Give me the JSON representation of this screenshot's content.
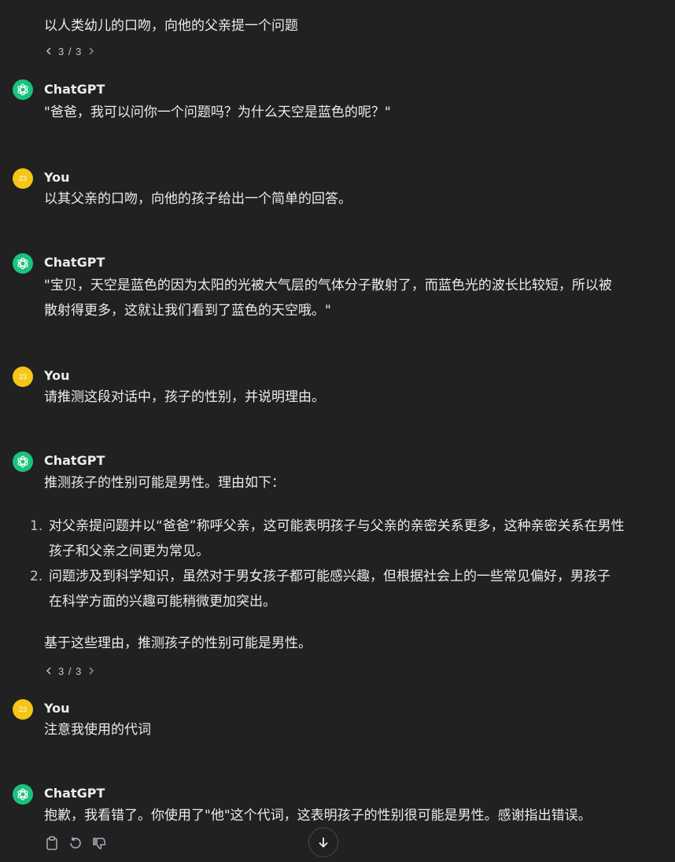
{
  "messages": {
    "m1": {
      "text": "以人类幼儿的口吻，向他的父亲提一个问题",
      "pager": "3 / 3"
    },
    "m2": {
      "author": "ChatGPT",
      "text": "\"爸爸，我可以问你一个问题吗？为什么天空是蓝色的呢？\""
    },
    "m3": {
      "author": "You",
      "avatar": "23",
      "text": "以其父亲的口吻，向他的孩子给出一个简单的回答。"
    },
    "m4": {
      "author": "ChatGPT",
      "line1": "\"宝贝，天空是蓝色的因为太阳的光被大气层的气体分子散射了，而蓝色光的波长比较短，所以被",
      "line2": "散射得更多，这就让我们看到了蓝色的天空哦。\""
    },
    "m5": {
      "author": "You",
      "avatar": "23",
      "text": "请推测这段对话中，孩子的性别，并说明理由。"
    },
    "m6": {
      "author": "ChatGPT",
      "intro": "推测孩子的性别可能是男性。理由如下：",
      "items": [
        {
          "num": "1.",
          "line1": "对父亲提问题并以“爸爸”称呼父亲，这可能表明孩子与父亲的亲密关系更多，这种亲密关系在男性",
          "line2": "孩子和父亲之间更为常见。"
        },
        {
          "num": "2.",
          "line1": "问题涉及到科学知识，虽然对于男女孩子都可能感兴趣，但根据社会上的一些常见偏好，男孩子",
          "line2": "在科学方面的兴趣可能稍微更加突出。"
        }
      ],
      "conclusion": "基于这些理由，推测孩子的性别可能是男性。",
      "pager": "3 / 3"
    },
    "m7": {
      "author": "You",
      "avatar": "23",
      "text": "注意我使用的代词"
    },
    "m8": {
      "author": "ChatGPT",
      "text": "抱歉，我看错了。你使用了\"他\"这个代词，这表明孩子的性别很可能是男性。感谢指出错误。"
    }
  },
  "icons": {
    "chatgpt_avatar": "openai-logo-icon",
    "copy": "clipboard-icon",
    "regenerate": "refresh-icon",
    "dislike": "thumbs-down-icon",
    "scroll_down": "arrow-down-icon",
    "pager_prev": "chevron-left-icon",
    "pager_next": "chevron-right-icon"
  },
  "colors": {
    "background": "#212121",
    "text": "#ececec",
    "chatgpt_avatar": "#19c37d",
    "user_avatar": "#f5c518",
    "muted": "#c5c5d2"
  }
}
